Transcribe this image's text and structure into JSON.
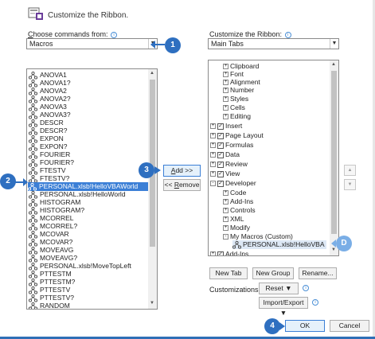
{
  "dialog": {
    "title": "Customize the Ribbon."
  },
  "left": {
    "label_underlined": "C",
    "label_rest": "hoose commands from:",
    "select_value": "Macros",
    "items": [
      "ANOVA1",
      "ANOVA1?",
      "ANOVA2",
      "ANOVA2?",
      "ANOVA3",
      "ANOVA3?",
      "DESCR",
      "DESCR?",
      "EXPON",
      "EXPON?",
      "FOURIER",
      "FOURIER?",
      "FTESTV",
      "FTESTV?",
      "PERSONAL.xlsb!HelloVBAWorld",
      "PERSONAL.xlsb!HelloWorld",
      "HISTOGRAM",
      "HISTOGRAM?",
      "MCORREL",
      "MCORREL?",
      "MCOVAR",
      "MCOVAR?",
      "MOVEAVG",
      "MOVEAVG?",
      "PERSONAL.xlsb!MoveTopLeft",
      "PTTESTM",
      "PTTESTM?",
      "PTTESTV",
      "PTTESTV?",
      "RANDOM"
    ],
    "selected_index": 14
  },
  "middle": {
    "add_label": "Add >>",
    "remove_label": "<< Remove"
  },
  "right": {
    "label": "Customize the Ribbon:",
    "select_value": "Main Tabs",
    "tree": [
      {
        "text": "Clipboard"
      },
      {
        "text": "Font"
      },
      {
        "text": "Alignment"
      },
      {
        "text": "Number"
      },
      {
        "text": "Styles"
      },
      {
        "text": "Cells"
      },
      {
        "text": "Editing"
      },
      {
        "text": "Insert"
      },
      {
        "text": "Page Layout"
      },
      {
        "text": "Formulas"
      },
      {
        "text": "Data"
      },
      {
        "text": "Review"
      },
      {
        "text": "View"
      },
      {
        "text": "Developer"
      },
      {
        "text": "Code"
      },
      {
        "text": "Add-Ins"
      },
      {
        "text": "Controls"
      },
      {
        "text": "XML"
      },
      {
        "text": "Modify"
      },
      {
        "text": "My Macros (Custom)"
      },
      {
        "text": "PERSONAL.xlsb!HelloVBA"
      },
      {
        "text": "Add-Ins"
      }
    ],
    "new_tab": "New Tab",
    "new_group": "New Group",
    "rename": "Rename...",
    "customizations_label": "Customizations:",
    "reset": "Reset ▼",
    "import_export": "Import/Export ▼"
  },
  "footer": {
    "ok": "OK",
    "cancel": "Cancel"
  },
  "callouts": {
    "c1": "1",
    "c2": "2",
    "c3": "3",
    "c4": "4",
    "cD": "D"
  },
  "colors": {
    "accent": "#2e6fc0",
    "selection": "#3b7fd6"
  }
}
